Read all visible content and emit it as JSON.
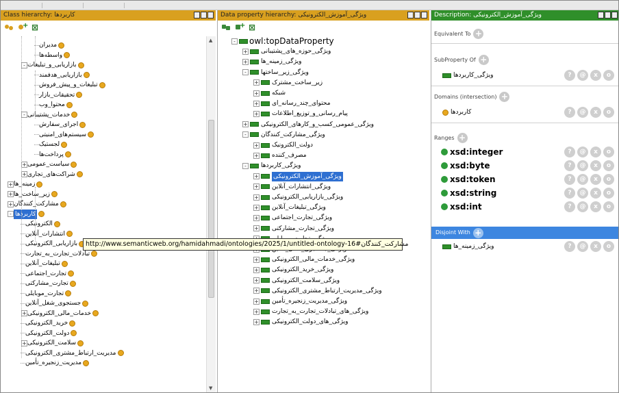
{
  "panels": {
    "class_hierarchy": {
      "title": "Class hierarchy: کاربردها"
    },
    "data_property_hierarchy": {
      "title": "Data property hierarchy: ویژگی_آموزش_الکترونیکی"
    },
    "description": {
      "title": "Description: ویژگی_آموزش_الکترونیکی"
    }
  },
  "class_tree": [
    {
      "label": "مدیران",
      "icon": "class",
      "depth": 3,
      "toggle": null
    },
    {
      "label": "واسطه‌ها",
      "icon": "class",
      "depth": 3,
      "toggle": null
    },
    {
      "label": "بازاریابی_و_تبلیغات",
      "icon": "class",
      "depth": 2,
      "toggle": "-"
    },
    {
      "label": "بازاریابی_هدفمند",
      "icon": "class",
      "depth": 3,
      "toggle": null
    },
    {
      "label": "تبلیغات_و_پیش_فروش",
      "icon": "class",
      "depth": 3,
      "toggle": null
    },
    {
      "label": "تحقیقات_بازار",
      "icon": "class",
      "depth": 3,
      "toggle": null
    },
    {
      "label": "محتوا_وب",
      "icon": "class",
      "depth": 3,
      "toggle": null
    },
    {
      "label": "خدمات_پشتیبانی",
      "icon": "class",
      "depth": 2,
      "toggle": "-"
    },
    {
      "label": "اجرای_سفارش",
      "icon": "class",
      "depth": 3,
      "toggle": null
    },
    {
      "label": "سیستم‌های_امنیتی",
      "icon": "class",
      "depth": 3,
      "toggle": null
    },
    {
      "label": "لجستیک",
      "icon": "class",
      "depth": 3,
      "toggle": null
    },
    {
      "label": "پرداخت‌ها",
      "icon": "class",
      "depth": 3,
      "toggle": null
    },
    {
      "label": "سیاست_عمومی",
      "icon": "class",
      "depth": 2,
      "toggle": "+"
    },
    {
      "label": "شراکت‌های_تجاری",
      "icon": "class",
      "depth": 2,
      "toggle": "+"
    },
    {
      "label": "زمینه_ها",
      "icon": "class",
      "depth": 1,
      "toggle": "+"
    },
    {
      "label": "زیر_ساخت_ها",
      "icon": "class",
      "depth": 1,
      "toggle": "+"
    },
    {
      "label": "مشارکت_کنندگان",
      "icon": "class",
      "depth": 1,
      "toggle": "+"
    },
    {
      "label": "کاربردها",
      "icon": "class",
      "depth": 1,
      "toggle": "-",
      "selected": true
    },
    {
      "label": "الکترونیکی",
      "icon": "class",
      "depth": 2,
      "toggle": null
    },
    {
      "label": "انتشارات_آنلاین",
      "icon": "class",
      "depth": 2,
      "toggle": null
    },
    {
      "label": "بازاریابی_الکترونیکی",
      "icon": "class",
      "depth": 2,
      "toggle": null
    },
    {
      "label": "تبادلات_تجارت_به_تجارت",
      "icon": "class",
      "depth": 2,
      "toggle": null
    },
    {
      "label": "تبلیغات_آنلاین",
      "icon": "class",
      "depth": 2,
      "toggle": null
    },
    {
      "label": "تجارت_اجتماعی",
      "icon": "class",
      "depth": 2,
      "toggle": null
    },
    {
      "label": "تجارت_مشارکتی",
      "icon": "class",
      "depth": 2,
      "toggle": null
    },
    {
      "label": "تجارت_موبایلی",
      "icon": "class",
      "depth": 2,
      "toggle": null
    },
    {
      "label": "جستجوی_شغل_آنلاین",
      "icon": "class",
      "depth": 2,
      "toggle": null
    },
    {
      "label": "خدمات_مالی_الکترونیکی",
      "icon": "class",
      "depth": 2,
      "toggle": "+"
    },
    {
      "label": "خرید_الکترونیکی",
      "icon": "class",
      "depth": 2,
      "toggle": null
    },
    {
      "label": "دولت_الکترونیکی",
      "icon": "class",
      "depth": 2,
      "toggle": null
    },
    {
      "label": "سلامت_الکترونیکی",
      "icon": "class",
      "depth": 2,
      "toggle": "+"
    },
    {
      "label": "مدیریت_ارتباط_مشتری_الکترونیکی",
      "icon": "class",
      "depth": 2,
      "toggle": null
    },
    {
      "label": "مدیریت_زنجیره_تأمین",
      "icon": "class",
      "depth": 2,
      "toggle": null
    }
  ],
  "property_tree": [
    {
      "label": "owl:topDataProperty",
      "depth": 0,
      "toggle": "-",
      "big": true
    },
    {
      "label": "ویژگی_حوزه_های_پشتیبانی",
      "depth": 1,
      "toggle": "+"
    },
    {
      "label": "ویژگی_زمینه_ها",
      "depth": 1,
      "toggle": "+"
    },
    {
      "label": "ویژگی_زیر_ساختها",
      "depth": 1,
      "toggle": "-"
    },
    {
      "label": "زیر_ساخت_مشترک",
      "depth": 2,
      "toggle": "+"
    },
    {
      "label": "شبکه",
      "depth": 2,
      "toggle": "+"
    },
    {
      "label": "محتوای_چند_رسانه_ای",
      "depth": 2,
      "toggle": "+"
    },
    {
      "label": "پیام_رسانی_و_توزیع_اطلاعات",
      "depth": 2,
      "toggle": "+"
    },
    {
      "label": "ویژگی_عمومی_کسب_و_کارهای_الکترونیکی",
      "depth": 1,
      "toggle": "+"
    },
    {
      "label": "ویژگی_مشارکت_کنندگان",
      "depth": 1,
      "toggle": "-"
    },
    {
      "label": "دولت_الکترونیک",
      "depth": 2,
      "toggle": "+"
    },
    {
      "label": "مصرف_کننده",
      "depth": 2,
      "toggle": "+"
    },
    {
      "label": "ویژگی_کاربردها",
      "depth": 1,
      "toggle": "-"
    },
    {
      "label": "ویژگی_آموزش_الکترونیکی",
      "depth": 2,
      "toggle": "+",
      "selected": true
    },
    {
      "label": "ویژگی_انتشارات_آنلاین",
      "depth": 2,
      "toggle": "+"
    },
    {
      "label": "ویژگی_بازاریابی_الکترونیکی",
      "depth": 2,
      "toggle": "+"
    },
    {
      "label": "ویژگی_تبلیغات_آنلاین",
      "depth": 2,
      "toggle": "+"
    },
    {
      "label": "ویژگی_تجارت_اجتماعی",
      "depth": 2,
      "toggle": "+"
    },
    {
      "label": "ویژگی_تجارت_مشارکتی",
      "depth": 2,
      "toggle": "+"
    },
    {
      "label": "ویژگی_تجارت_موبایلی",
      "depth": 2,
      "toggle": "+"
    },
    {
      "label": "ویژگی_جستجوی_شغل_آنلاین",
      "depth": 2,
      "toggle": "+"
    },
    {
      "label": "ویژگی_خدمات_مالی_الکترونیکی",
      "depth": 2,
      "toggle": "+"
    },
    {
      "label": "ویژگی_خرید_الکترونیکی",
      "depth": 2,
      "toggle": "+"
    },
    {
      "label": "ویژگی_سلامت_الکترونیکی",
      "depth": 2,
      "toggle": "+"
    },
    {
      "label": "ویژگی_مدیریت_ارتباط_مشتری_الکترونیکی",
      "depth": 2,
      "toggle": "+"
    },
    {
      "label": "ویژگی_مدیریت_زنجیره_تأمین",
      "depth": 2,
      "toggle": "+"
    },
    {
      "label": "ویژگی_های_تبادلات_تجارت_به_تجارت",
      "depth": 2,
      "toggle": "+"
    },
    {
      "label": "ویژگی_های_دولت_الکترونیکی",
      "depth": 2,
      "toggle": "+"
    }
  ],
  "tooltip": "http://www.semanticweb.org/hamidahmadi/ontologies/2025/1/untitled-ontology-16#مشارکت_کنندگان",
  "description": {
    "equivalent_to": {
      "label": "Equivalent To"
    },
    "subproperty_of": {
      "label": "SubProperty Of",
      "items": [
        "ویژگی_کاربردها"
      ]
    },
    "domains": {
      "label": "Domains (intersection)",
      "items": [
        "کاربردها"
      ]
    },
    "ranges": {
      "label": "Ranges",
      "items": [
        "xsd:integer",
        "xsd:byte",
        "xsd:token",
        "xsd:string",
        "xsd:int"
      ]
    },
    "disjoint_with": {
      "label": "Disjoint With",
      "items": [
        "ویژگی_زمینه_ها"
      ]
    }
  },
  "action_icons": {
    "annotate": "?",
    "info": "@",
    "remove": "x",
    "edit": "o"
  },
  "colors": {
    "class_header": "#d9a01f",
    "description_header": "#2f8f2a",
    "selection": "#2e6fd1",
    "disjoint_bar": "#3d86e0"
  }
}
